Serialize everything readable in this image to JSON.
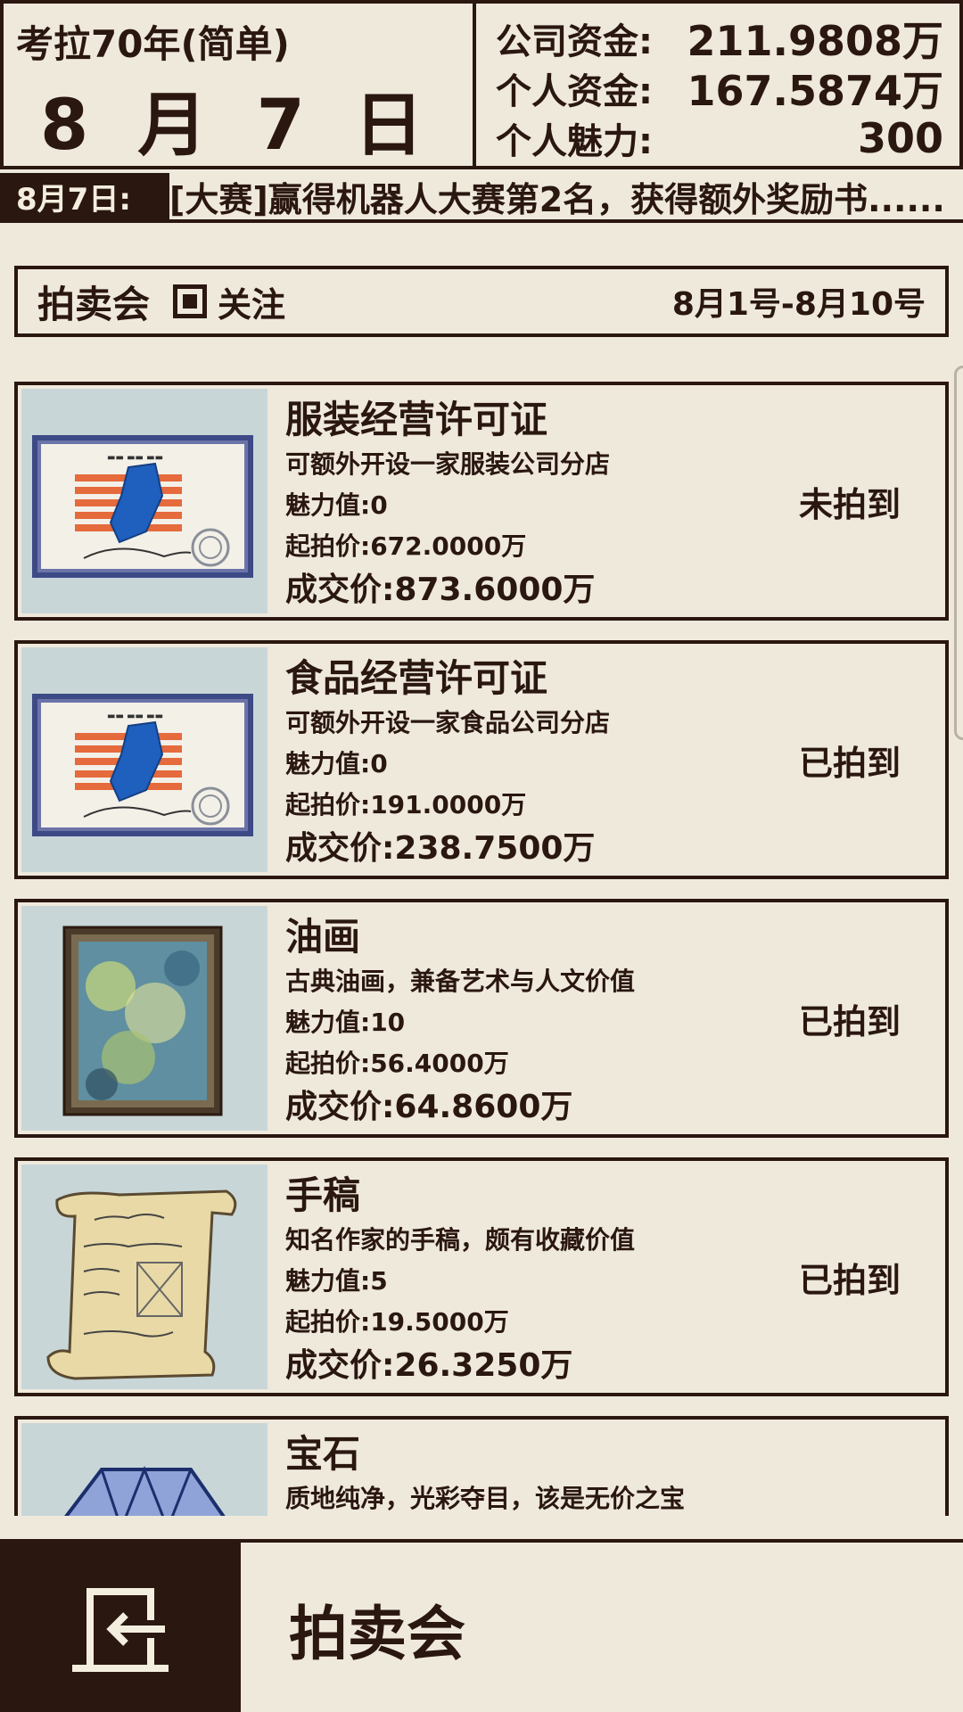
{
  "header": {
    "game_title": "考拉70年(简单)",
    "date": "8 月 7 日",
    "stats": [
      {
        "label": "公司资金:",
        "value": "211.9808万"
      },
      {
        "label": "个人资金:",
        "value": "167.5874万"
      },
      {
        "label": "个人魅力:",
        "value": "300"
      }
    ]
  },
  "ticker": {
    "date": "8月7日:",
    "text": "[大赛]赢得机器人大赛第2名，获得额外奖励书......."
  },
  "section": {
    "title": "拍卖会",
    "follow_label": "关注",
    "date_range": "8月1号-8月10号"
  },
  "items": [
    {
      "name": "服装经营许可证",
      "desc": "可额外开设一家服装公司分店",
      "charm": "魅力值:0",
      "start_price": "起拍价:672.0000万",
      "deal_price": "成交价:873.6000万",
      "status": "未拍到",
      "icon": "license-icon"
    },
    {
      "name": "食品经营许可证",
      "desc": "可额外开设一家食品公司分店",
      "charm": "魅力值:0",
      "start_price": "起拍价:191.0000万",
      "deal_price": "成交价:238.7500万",
      "status": "已拍到",
      "icon": "license-icon"
    },
    {
      "name": "油画",
      "desc": "古典油画，兼备艺术与人文价值",
      "charm": "魅力值:10",
      "start_price": "起拍价:56.4000万",
      "deal_price": "成交价:64.8600万",
      "status": "已拍到",
      "icon": "oil-painting-icon"
    },
    {
      "name": "手稿",
      "desc": "知名作家的手稿，颇有收藏价值",
      "charm": "魅力值:5",
      "start_price": "起拍价:19.5000万",
      "deal_price": "成交价:26.3250万",
      "status": "已拍到",
      "icon": "manuscript-icon"
    },
    {
      "name": "宝石",
      "desc": "质地纯净，光彩夺目，该是无价之宝",
      "charm": "",
      "start_price": "",
      "deal_price": "",
      "status": "",
      "icon": "gem-icon"
    }
  ],
  "bottom": {
    "title": "拍卖会",
    "back_icon": "exit-icon"
  },
  "colors": {
    "background": "#efe9dc",
    "ink": "#2a1710",
    "thumb_bg": "#c8d6d8"
  }
}
